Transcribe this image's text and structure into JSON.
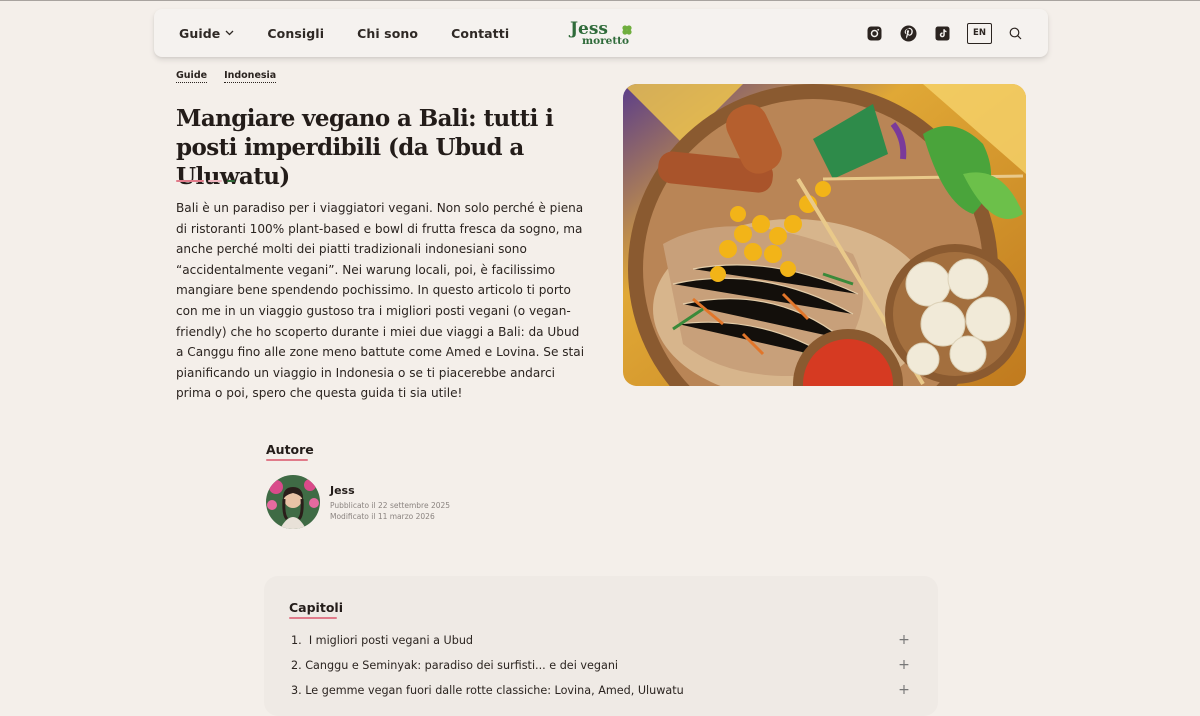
{
  "header": {
    "nav": [
      {
        "label": "Guide",
        "has_dropdown": true
      },
      {
        "label": "Consigli"
      },
      {
        "label": "Chi sono"
      },
      {
        "label": "Contatti"
      }
    ],
    "logo_line1": "Jess",
    "logo_line2": "moretto",
    "icons": [
      "instagram-icon",
      "pinterest-icon",
      "tiktok-icon",
      "search-icon"
    ],
    "language": "EN"
  },
  "breadcrumb": [
    "Guide",
    "Indonesia"
  ],
  "article": {
    "title": "Mangiare vegano a Bali: tutti i posti imperdibili (da Ubud a Uluwatu)",
    "intro": "Bali è un paradiso per i viaggiatori vegani. Non solo perché è piena di ristoranti 100% plant-based e bowl di frutta fresca da sogno, ma anche perché molti dei piatti tradizionali indonesiani sono “accidentalmente vegani”. Nei warung locali, poi, è facilissimo mangiare bene spendendo pochissimo. In questo articolo ti porto con me in un viaggio gustoso tra i migliori posti vegani (o vegan-friendly) che ho scoperto durante i miei due viaggi a Bali: da Ubud a Canggu fino alle zone meno battute come Amed e Lovina. Se stai pianificando un viaggio in Indonesia o se ti piacerebbe andarci prima o poi, spero che questa guida ti sia utile!"
  },
  "author": {
    "heading": "Autore",
    "name": "Jess",
    "published": "Pubblicato il 22 settembre 2025",
    "modified": "Modificato il 11 marzo 2026"
  },
  "chapters": {
    "heading": "Capitoli",
    "items": [
      {
        "num": "1.",
        "label": "I migliori posti vegani a Ubud"
      },
      {
        "num": "2.",
        "label": "Canggu e Seminyak: paradiso dei surfisti... e dei vegani"
      },
      {
        "num": "3.",
        "label": "Le gemme vegan fuori dalle rotte classiche: Lovina, Amed, Uluwatu"
      }
    ]
  },
  "colors": {
    "background": "#f4efea",
    "accent_pink": "#e07b8a",
    "brand_green": "#2f6b3a",
    "text": "#2b2420"
  }
}
